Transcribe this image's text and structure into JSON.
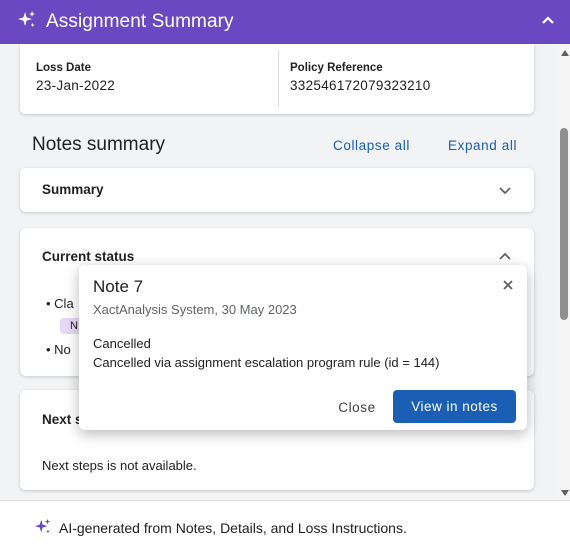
{
  "header": {
    "title": "Assignment Summary",
    "icon": "sparkle-icon",
    "color": "#6a48c2"
  },
  "claim": {
    "loss_date_label": "Loss Date",
    "loss_date_value": "23-Jan-2022",
    "policy_label": "Policy Reference",
    "policy_value": "332546172079323210"
  },
  "notes": {
    "title": "Notes summary",
    "collapse_all": "Collapse all",
    "expand_all": "Expand all",
    "sections": [
      {
        "label": "Summary",
        "expanded": false
      },
      {
        "label": "Current status",
        "expanded": true,
        "bullets": [
          "Cla",
          "No"
        ],
        "chip": "N"
      },
      {
        "label": "Next s",
        "expanded": true,
        "body": "Next steps is not available."
      }
    ]
  },
  "popup": {
    "title": "Note 7",
    "subtitle": "XactAnalysis System, 30 May 2023",
    "status": "Cancelled",
    "description": "Cancelled via assignment escalation program rule (id = 144)",
    "close_label": "Close",
    "view_label": "View in notes"
  },
  "footer": {
    "text": "AI-generated from Notes, Details, and Loss Instructions."
  },
  "colors": {
    "accent": "#1a5fb4",
    "brand": "#6a48c2",
    "chip": "#e6d8f7"
  }
}
